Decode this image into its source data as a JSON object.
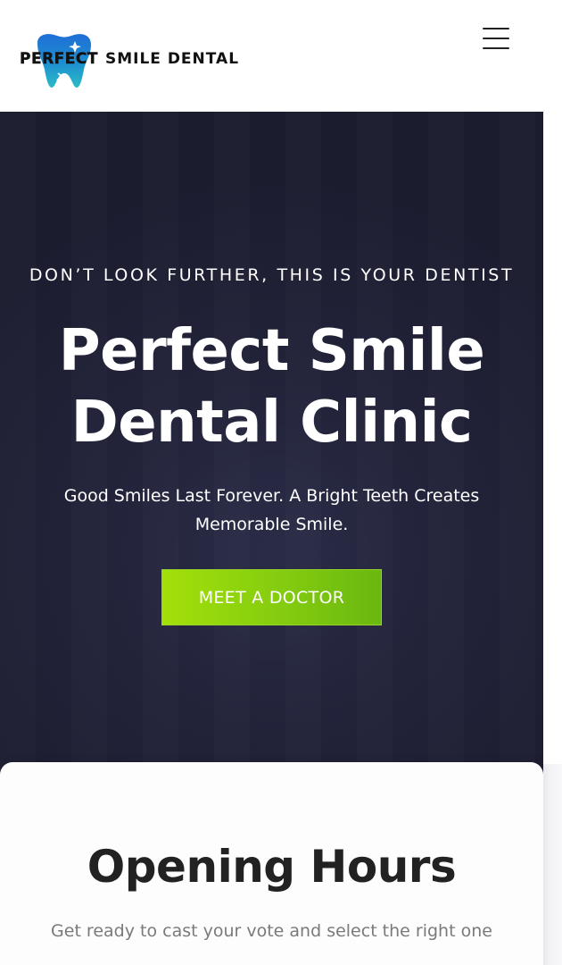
{
  "header": {
    "logo": {
      "word_1": "PERFECT",
      "word_2": "SMILE DENTAL",
      "icon": "tooth-logo-icon"
    },
    "menu_icon": "hamburger-menu-icon"
  },
  "hero": {
    "eyebrow": "DON’T LOOK FURTHER, THIS IS YOUR DENTIST",
    "title_line_1": "Perfect Smile",
    "title_line_2": "Dental Clinic",
    "subtitle_line_1": "Good Smiles Last Forever. A Bright Teeth Creates",
    "subtitle_line_2": "Memorable Smile.",
    "cta_label": "MEET A DOCTOR"
  },
  "opening_hours": {
    "title": "Opening Hours",
    "subtitle": "Get ready to cast your vote and select the right one"
  },
  "colors": {
    "hero_background": "#23243b",
    "cta_start": "#a3e00a",
    "cta_end": "#6ab70f",
    "logo_blue": "#1e7fd0",
    "logo_teal": "#2bb3c4"
  }
}
